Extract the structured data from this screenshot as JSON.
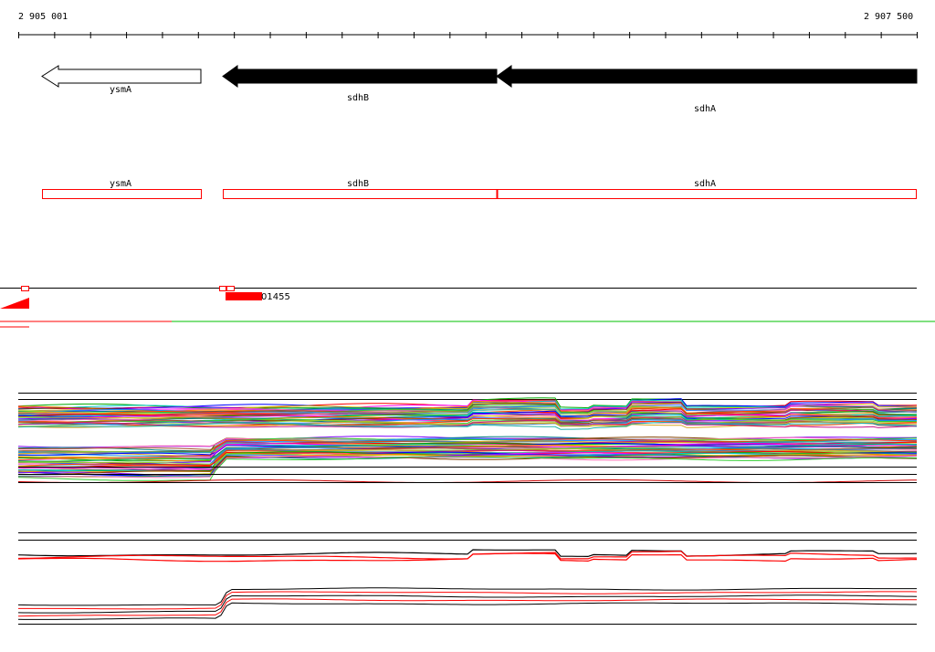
{
  "ruler": {
    "start_label": "2 905 001",
    "end_label": "2 907 500"
  },
  "genes": [
    {
      "name": "ysmA",
      "strand": "minus",
      "style": "outline"
    },
    {
      "name": "sdhB",
      "strand": "minus",
      "style": "filled"
    },
    {
      "name": "sdhA",
      "strand": "minus",
      "style": "filled"
    }
  ],
  "annotation_track": {
    "features": [
      {
        "name": "ysmA"
      },
      {
        "name": "sdhB"
      },
      {
        "name": "sdhA"
      }
    ]
  },
  "coverage_track": {
    "feature_label": "01455"
  },
  "colors": {
    "gene_filled": "#000000",
    "annotation_box": "#ff0000",
    "coverage": "#ff0000",
    "green_line": "#00c000",
    "red_line": "#ff0000",
    "axis": "#000000"
  }
}
